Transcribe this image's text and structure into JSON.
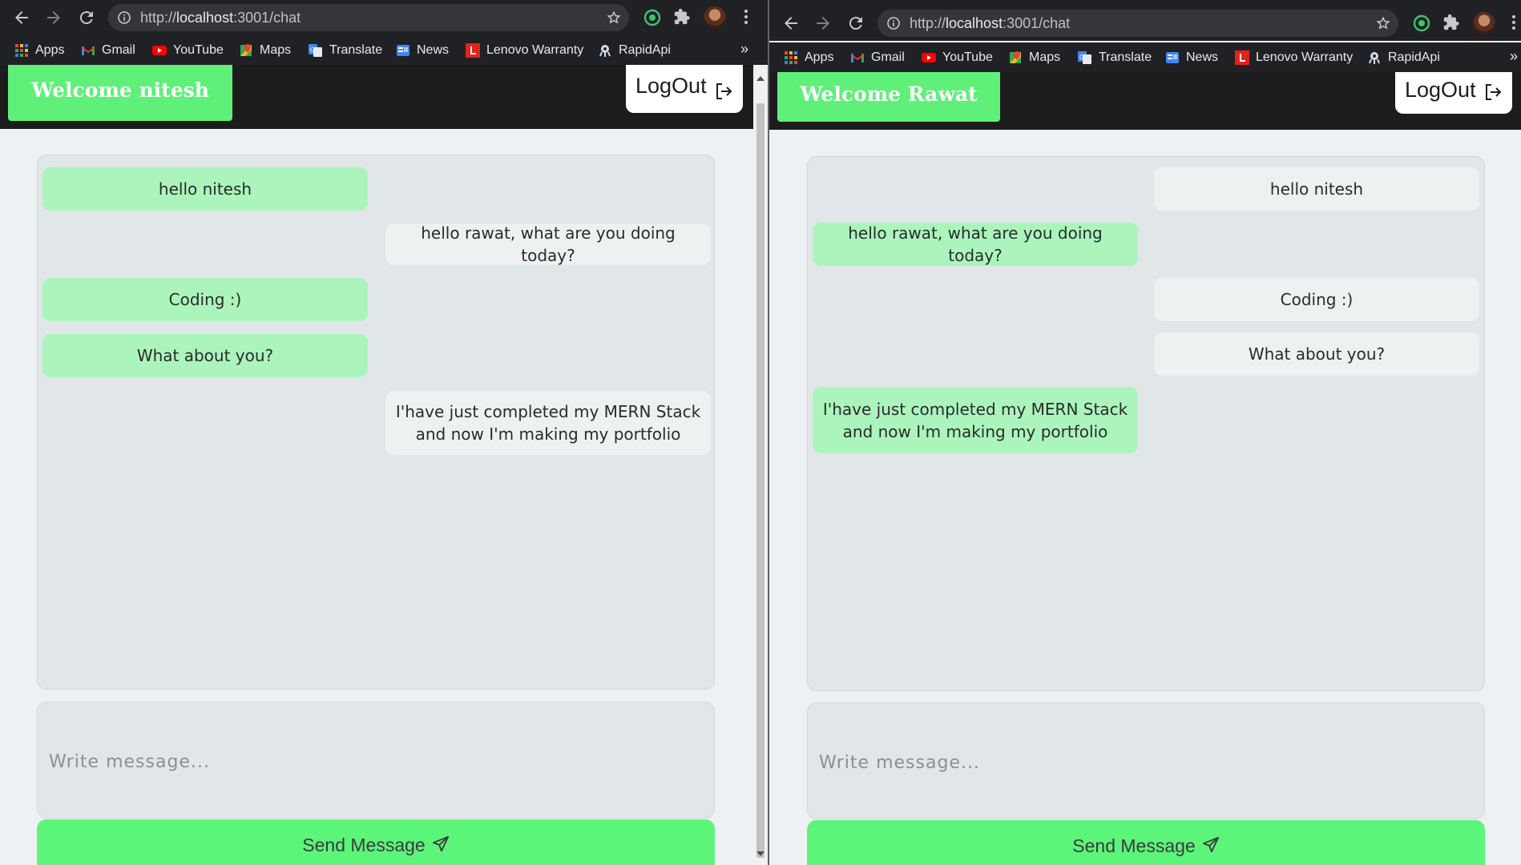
{
  "windows": [
    {
      "url_scheme": "http://",
      "url_host": "localhost",
      "url_rest": ":3001/chat",
      "bookmarks": [
        {
          "label": "Apps",
          "icon": "apps-grid-icon"
        },
        {
          "label": "Gmail",
          "icon": "gmail-icon"
        },
        {
          "label": "YouTube",
          "icon": "youtube-icon"
        },
        {
          "label": "Maps",
          "icon": "maps-icon"
        },
        {
          "label": "Translate",
          "icon": "translate-icon"
        },
        {
          "label": "News",
          "icon": "news-icon"
        },
        {
          "label": "Lenovo Warranty",
          "icon": "lenovo-icon"
        },
        {
          "label": "RapidApi",
          "icon": "rapidapi-icon"
        }
      ],
      "bookmarks_overflow": "»",
      "welcome": "Welcome nitesh",
      "logout": "LogOut",
      "messages": [
        {
          "text": "hello nitesh",
          "side": "left"
        },
        {
          "text": "hello rawat, what are you doing today?",
          "side": "right"
        },
        {
          "text": "Coding :)",
          "side": "left"
        },
        {
          "text": "What about you?",
          "side": "left"
        },
        {
          "text": "I'have just completed my MERN Stack and now I'm making my portfolio",
          "side": "right"
        }
      ],
      "composer_placeholder": "Write message...",
      "send_label": "Send Message"
    },
    {
      "url_scheme": "http://",
      "url_host": "localhost",
      "url_rest": ":3001/chat",
      "bookmarks": [
        {
          "label": "Apps",
          "icon": "apps-grid-icon"
        },
        {
          "label": "Gmail",
          "icon": "gmail-icon"
        },
        {
          "label": "YouTube",
          "icon": "youtube-icon"
        },
        {
          "label": "Maps",
          "icon": "maps-icon"
        },
        {
          "label": "Translate",
          "icon": "translate-icon"
        },
        {
          "label": "News",
          "icon": "news-icon"
        },
        {
          "label": "Lenovo Warranty",
          "icon": "lenovo-icon"
        },
        {
          "label": "RapidApi",
          "icon": "rapidapi-icon"
        }
      ],
      "bookmarks_overflow": "»",
      "welcome": "Welcome Rawat",
      "logout": "LogOut",
      "messages": [
        {
          "text": "hello nitesh",
          "side": "right"
        },
        {
          "text": "hello rawat, what are you doing today?",
          "side": "left"
        },
        {
          "text": "Coding :)",
          "side": "right"
        },
        {
          "text": "What about you?",
          "side": "right"
        },
        {
          "text": "I'have just completed my MERN Stack and now I'm making my portfolio",
          "side": "left"
        }
      ],
      "composer_placeholder": "Write message...",
      "send_label": "Send Message"
    }
  ],
  "colors": {
    "welcome_green": "#5ff07a",
    "bubble_green": "#abf5bd",
    "bubble_gray": "#eef1f2",
    "send_green": "#5bf57a",
    "header_dark": "#1c1c1c"
  }
}
